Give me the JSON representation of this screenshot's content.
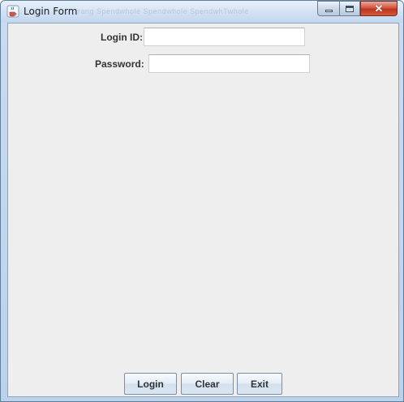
{
  "window": {
    "title": "Login Form",
    "background_titles": "rang   Spendwhole    Spendwhole    SpendwhTwhole"
  },
  "form": {
    "login_id": {
      "label": "Login ID:",
      "value": ""
    },
    "password": {
      "label": "Password:",
      "value": ""
    }
  },
  "buttons": {
    "login": "Login",
    "clear": "Clear",
    "exit": "Exit"
  },
  "colors": {
    "client_bg": "#eeeeee",
    "close_button": "#c2331c",
    "titlebar": "#cfe0f2"
  },
  "icons": {
    "app": "java-coffee-cup-icon",
    "minimize": "minimize-icon",
    "maximize": "maximize-icon",
    "close": "close-icon"
  }
}
